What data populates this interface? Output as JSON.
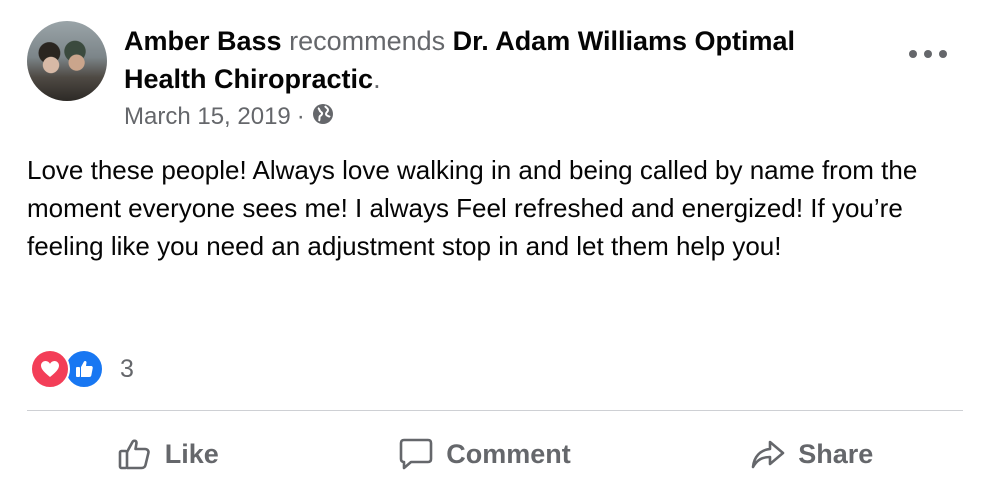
{
  "post": {
    "author": "Amber Bass",
    "verb": "recommends",
    "page_name": "Dr. Adam Williams Optimal Health Chiropractic",
    "period": ".",
    "date": "March 15, 2019",
    "separator": "·",
    "privacy_icon": "globe-icon",
    "more_icon": "more-options-icon",
    "body": "Love these people! Always love walking in and being called by name from the moment everyone sees me! I always Feel refreshed and energized! If you’re feeling like you need an adjustment stop in and let them help you!"
  },
  "reactions": {
    "icons": [
      "love-reaction-icon",
      "like-reaction-icon"
    ],
    "count": "3",
    "colors": {
      "love": "#f33e58",
      "like": "#1877f2"
    }
  },
  "actions": {
    "like": "Like",
    "comment": "Comment",
    "share": "Share"
  },
  "colors": {
    "primary_text": "#050505",
    "secondary_text": "#65676b",
    "divider": "#ced0d4"
  }
}
